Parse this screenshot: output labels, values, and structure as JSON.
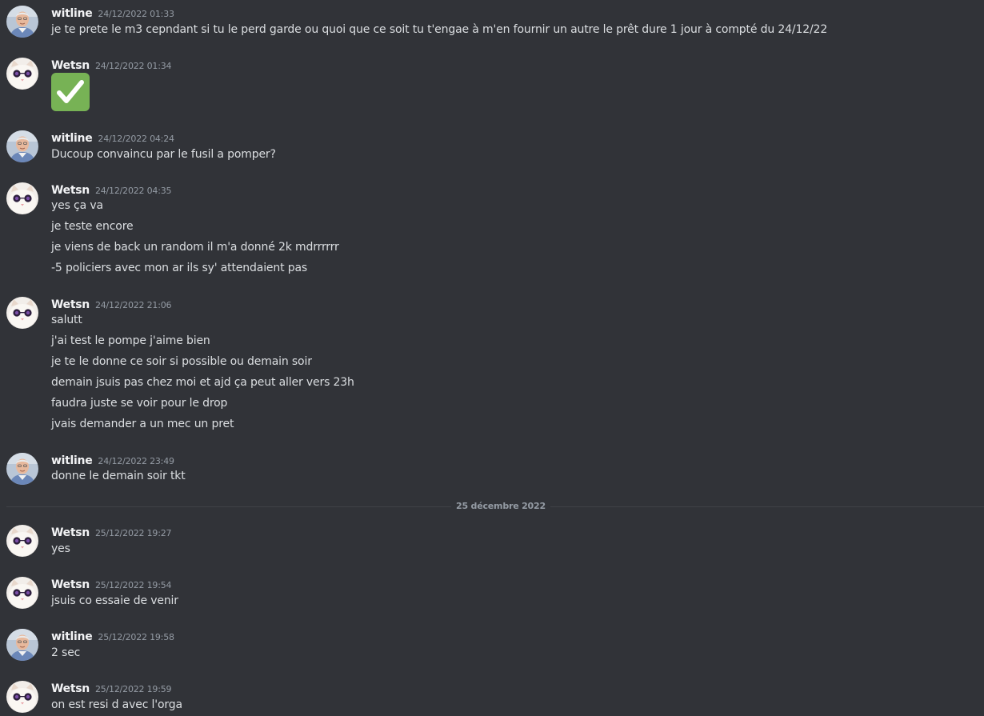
{
  "users": {
    "witline": {
      "name": "witline",
      "avatar_icon": "old-man-avatar-icon"
    },
    "wetsn": {
      "name": "Wetsn",
      "avatar_icon": "cat-sunglasses-avatar-icon"
    }
  },
  "messages": [
    {
      "author": "witline",
      "timestamp": "24/12/2022 01:33",
      "lines": [
        "je te prete le m3 cepndant si tu le perd garde ou quoi que ce soit tu t'engae à m'en fournir un autre le prêt dure 1 jour à compté du 24/12/22"
      ]
    },
    {
      "author": "Wetsn",
      "timestamp": "24/12/2022 01:34",
      "lines": [],
      "emoji": "white-check-mark-icon"
    },
    {
      "author": "witline",
      "timestamp": "24/12/2022 04:24",
      "lines": [
        "Ducoup convaincu par le fusil a pomper?"
      ]
    },
    {
      "author": "Wetsn",
      "timestamp": "24/12/2022 04:35",
      "lines": [
        "yes ça va",
        "je teste encore",
        "je viens de back un random il m'a donné 2k mdrrrrrr",
        "-5 policiers avec mon ar ils sy' attendaient pas"
      ]
    },
    {
      "author": "Wetsn",
      "timestamp": "24/12/2022 21:06",
      "lines": [
        "salutt",
        "j'ai test le pompe j'aime bien",
        "je te le donne ce soir si possible ou demain soir",
        "demain jsuis pas chez moi et ajd ça peut aller vers 23h",
        "faudra juste se voir pour le drop",
        "jvais demander a un mec un pret"
      ]
    },
    {
      "author": "witline",
      "timestamp": "24/12/2022 23:49",
      "lines": [
        "donne le demain soir tkt"
      ]
    },
    {
      "author": "Wetsn",
      "timestamp": "25/12/2022 19:27",
      "lines": [
        "yes"
      ]
    },
    {
      "author": "Wetsn",
      "timestamp": "25/12/2022 19:54",
      "lines": [
        "jsuis co essaie de venir"
      ]
    },
    {
      "author": "witline",
      "timestamp": "25/12/2022 19:58",
      "lines": [
        "2 sec"
      ]
    },
    {
      "author": "Wetsn",
      "timestamp": "25/12/2022 19:59",
      "lines": [
        "on est resi d avec l'orga"
      ]
    }
  ],
  "date_divider": {
    "label": "25 décembre 2022"
  },
  "colors": {
    "background": "#313338",
    "username": "#f2f3f5",
    "timestamp": "#949ba4",
    "text": "#dbdee1",
    "divider": "#3f4147",
    "check_emoji": "#77b255"
  }
}
